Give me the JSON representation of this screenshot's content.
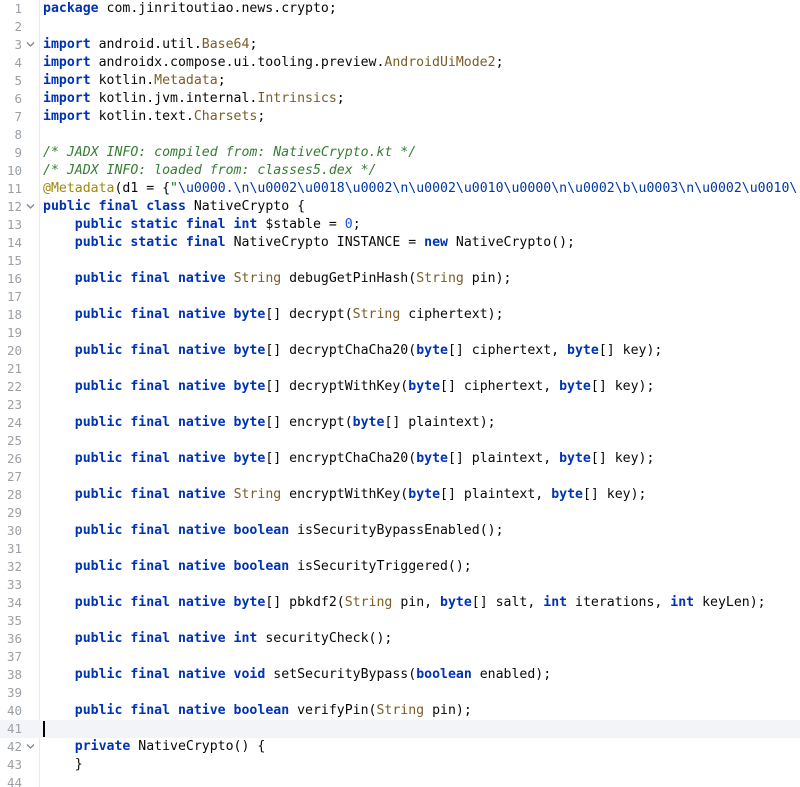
{
  "editor": {
    "caret_line": 41,
    "lines": [
      {
        "n": "1",
        "fold": "",
        "tokens": [
          [
            "kw",
            "package"
          ],
          [
            "pl",
            " com.jinritoutiao.news.crypto;"
          ]
        ]
      },
      {
        "n": "2",
        "fold": "",
        "tokens": []
      },
      {
        "n": "3",
        "fold": "v",
        "tokens": [
          [
            "kw",
            "import"
          ],
          [
            "pl",
            " android.util."
          ],
          [
            "ty",
            "Base64"
          ],
          [
            "pl",
            ";"
          ]
        ]
      },
      {
        "n": "4",
        "fold": "",
        "tokens": [
          [
            "kw",
            "import"
          ],
          [
            "pl",
            " androidx.compose.ui.tooling.preview."
          ],
          [
            "ty",
            "AndroidUiMode2"
          ],
          [
            "pl",
            ";"
          ]
        ]
      },
      {
        "n": "5",
        "fold": "",
        "tokens": [
          [
            "kw",
            "import"
          ],
          [
            "pl",
            " kotlin."
          ],
          [
            "ty",
            "Metadata"
          ],
          [
            "pl",
            ";"
          ]
        ]
      },
      {
        "n": "6",
        "fold": "",
        "tokens": [
          [
            "kw",
            "import"
          ],
          [
            "pl",
            " kotlin.jvm.internal."
          ],
          [
            "ty",
            "Intrinsics"
          ],
          [
            "pl",
            ";"
          ]
        ]
      },
      {
        "n": "7",
        "fold": "",
        "tokens": [
          [
            "kw",
            "import"
          ],
          [
            "pl",
            " kotlin.text."
          ],
          [
            "ty",
            "Charsets"
          ],
          [
            "pl",
            ";"
          ]
        ]
      },
      {
        "n": "8",
        "fold": "",
        "tokens": []
      },
      {
        "n": "9",
        "fold": "",
        "tokens": [
          [
            "cm",
            "/* JADX INFO: compiled from: NativeCrypto.kt */"
          ]
        ]
      },
      {
        "n": "10",
        "fold": "",
        "tokens": [
          [
            "cm",
            "/* JADX INFO: loaded from: classes5.dex */"
          ]
        ]
      },
      {
        "n": "11",
        "fold": "",
        "tokens": [
          [
            "an",
            "@Metadata"
          ],
          [
            "pl",
            "(d1 = {"
          ],
          [
            "str",
            "\""
          ],
          [
            "esc",
            "\\u0000."
          ],
          [
            "esc",
            "\\n"
          ],
          [
            "esc",
            "\\u0002\\u0018\\u0002"
          ],
          [
            "esc",
            "\\n"
          ],
          [
            "esc",
            "\\u0002\\u0010\\u0000"
          ],
          [
            "esc",
            "\\n"
          ],
          [
            "esc",
            "\\u0002\\b\\u0003"
          ],
          [
            "esc",
            "\\n"
          ],
          [
            "esc",
            "\\u0002\\u0010\\"
          ]
        ]
      },
      {
        "n": "12",
        "fold": "v",
        "tokens": [
          [
            "kw",
            "public final class"
          ],
          [
            "pl",
            " NativeCrypto {"
          ]
        ]
      },
      {
        "n": "13",
        "fold": "",
        "tokens": [
          [
            "pl",
            "    "
          ],
          [
            "kw",
            "public static final int"
          ],
          [
            "pl",
            " $stable = "
          ],
          [
            "num",
            "0"
          ],
          [
            "pl",
            ";"
          ]
        ]
      },
      {
        "n": "14",
        "fold": "",
        "tokens": [
          [
            "pl",
            "    "
          ],
          [
            "kw",
            "public static final"
          ],
          [
            "pl",
            " NativeCrypto INSTANCE = "
          ],
          [
            "kw",
            "new"
          ],
          [
            "pl",
            " NativeCrypto();"
          ]
        ]
      },
      {
        "n": "15",
        "fold": "",
        "tokens": []
      },
      {
        "n": "16",
        "fold": "",
        "tokens": [
          [
            "pl",
            "    "
          ],
          [
            "kw",
            "public final native"
          ],
          [
            "pl",
            " "
          ],
          [
            "ty",
            "String"
          ],
          [
            "pl",
            " debugGetPinHash("
          ],
          [
            "ty",
            "String"
          ],
          [
            "pl",
            " pin);"
          ]
        ]
      },
      {
        "n": "17",
        "fold": "",
        "tokens": []
      },
      {
        "n": "18",
        "fold": "",
        "tokens": [
          [
            "pl",
            "    "
          ],
          [
            "kw",
            "public final native byte"
          ],
          [
            "pl",
            "[] decrypt("
          ],
          [
            "ty",
            "String"
          ],
          [
            "pl",
            " ciphertext);"
          ]
        ]
      },
      {
        "n": "19",
        "fold": "",
        "tokens": []
      },
      {
        "n": "20",
        "fold": "",
        "tokens": [
          [
            "pl",
            "    "
          ],
          [
            "kw",
            "public final native byte"
          ],
          [
            "pl",
            "[] decryptChaCha20("
          ],
          [
            "kw",
            "byte"
          ],
          [
            "pl",
            "[] ciphertext, "
          ],
          [
            "kw",
            "byte"
          ],
          [
            "pl",
            "[] key);"
          ]
        ]
      },
      {
        "n": "21",
        "fold": "",
        "tokens": []
      },
      {
        "n": "22",
        "fold": "",
        "tokens": [
          [
            "pl",
            "    "
          ],
          [
            "kw",
            "public final native byte"
          ],
          [
            "pl",
            "[] decryptWithKey("
          ],
          [
            "kw",
            "byte"
          ],
          [
            "pl",
            "[] ciphertext, "
          ],
          [
            "kw",
            "byte"
          ],
          [
            "pl",
            "[] key);"
          ]
        ]
      },
      {
        "n": "23",
        "fold": "",
        "tokens": []
      },
      {
        "n": "24",
        "fold": "",
        "tokens": [
          [
            "pl",
            "    "
          ],
          [
            "kw",
            "public final native byte"
          ],
          [
            "pl",
            "[] encrypt("
          ],
          [
            "kw",
            "byte"
          ],
          [
            "pl",
            "[] plaintext);"
          ]
        ]
      },
      {
        "n": "25",
        "fold": "",
        "tokens": []
      },
      {
        "n": "26",
        "fold": "",
        "tokens": [
          [
            "pl",
            "    "
          ],
          [
            "kw",
            "public final native byte"
          ],
          [
            "pl",
            "[] encryptChaCha20("
          ],
          [
            "kw",
            "byte"
          ],
          [
            "pl",
            "[] plaintext, "
          ],
          [
            "kw",
            "byte"
          ],
          [
            "pl",
            "[] key);"
          ]
        ]
      },
      {
        "n": "27",
        "fold": "",
        "tokens": []
      },
      {
        "n": "28",
        "fold": "",
        "tokens": [
          [
            "pl",
            "    "
          ],
          [
            "kw",
            "public final native"
          ],
          [
            "pl",
            " "
          ],
          [
            "ty",
            "String"
          ],
          [
            "pl",
            " encryptWithKey("
          ],
          [
            "kw",
            "byte"
          ],
          [
            "pl",
            "[] plaintext, "
          ],
          [
            "kw",
            "byte"
          ],
          [
            "pl",
            "[] key);"
          ]
        ]
      },
      {
        "n": "29",
        "fold": "",
        "tokens": []
      },
      {
        "n": "30",
        "fold": "",
        "tokens": [
          [
            "pl",
            "    "
          ],
          [
            "kw",
            "public final native boolean"
          ],
          [
            "pl",
            " isSecurityBypassEnabled();"
          ]
        ]
      },
      {
        "n": "31",
        "fold": "",
        "tokens": []
      },
      {
        "n": "32",
        "fold": "",
        "tokens": [
          [
            "pl",
            "    "
          ],
          [
            "kw",
            "public final native boolean"
          ],
          [
            "pl",
            " isSecurityTriggered();"
          ]
        ]
      },
      {
        "n": "33",
        "fold": "",
        "tokens": []
      },
      {
        "n": "34",
        "fold": "",
        "tokens": [
          [
            "pl",
            "    "
          ],
          [
            "kw",
            "public final native byte"
          ],
          [
            "pl",
            "[] pbkdf2("
          ],
          [
            "ty",
            "String"
          ],
          [
            "pl",
            " pin, "
          ],
          [
            "kw",
            "byte"
          ],
          [
            "pl",
            "[] salt, "
          ],
          [
            "kw",
            "int"
          ],
          [
            "pl",
            " iterations, "
          ],
          [
            "kw",
            "int"
          ],
          [
            "pl",
            " keyLen);"
          ]
        ]
      },
      {
        "n": "35",
        "fold": "",
        "tokens": []
      },
      {
        "n": "36",
        "fold": "",
        "tokens": [
          [
            "pl",
            "    "
          ],
          [
            "kw",
            "public final native int"
          ],
          [
            "pl",
            " securityCheck();"
          ]
        ]
      },
      {
        "n": "37",
        "fold": "",
        "tokens": []
      },
      {
        "n": "38",
        "fold": "",
        "tokens": [
          [
            "pl",
            "    "
          ],
          [
            "kw",
            "public final native void"
          ],
          [
            "pl",
            " setSecurityBypass("
          ],
          [
            "kw",
            "boolean"
          ],
          [
            "pl",
            " enabled);"
          ]
        ]
      },
      {
        "n": "39",
        "fold": "",
        "tokens": []
      },
      {
        "n": "40",
        "fold": "",
        "tokens": [
          [
            "pl",
            "    "
          ],
          [
            "kw",
            "public final native boolean"
          ],
          [
            "pl",
            " verifyPin("
          ],
          [
            "ty",
            "String"
          ],
          [
            "pl",
            " pin);"
          ]
        ]
      },
      {
        "n": "41",
        "fold": "",
        "tokens": []
      },
      {
        "n": "42",
        "fold": "v",
        "tokens": [
          [
            "pl",
            "    "
          ],
          [
            "kw",
            "private"
          ],
          [
            "pl",
            " NativeCrypto() {"
          ]
        ]
      },
      {
        "n": "43",
        "fold": "",
        "tokens": [
          [
            "pl",
            "    }"
          ]
        ]
      },
      {
        "n": "44",
        "fold": "",
        "tokens": []
      }
    ]
  }
}
